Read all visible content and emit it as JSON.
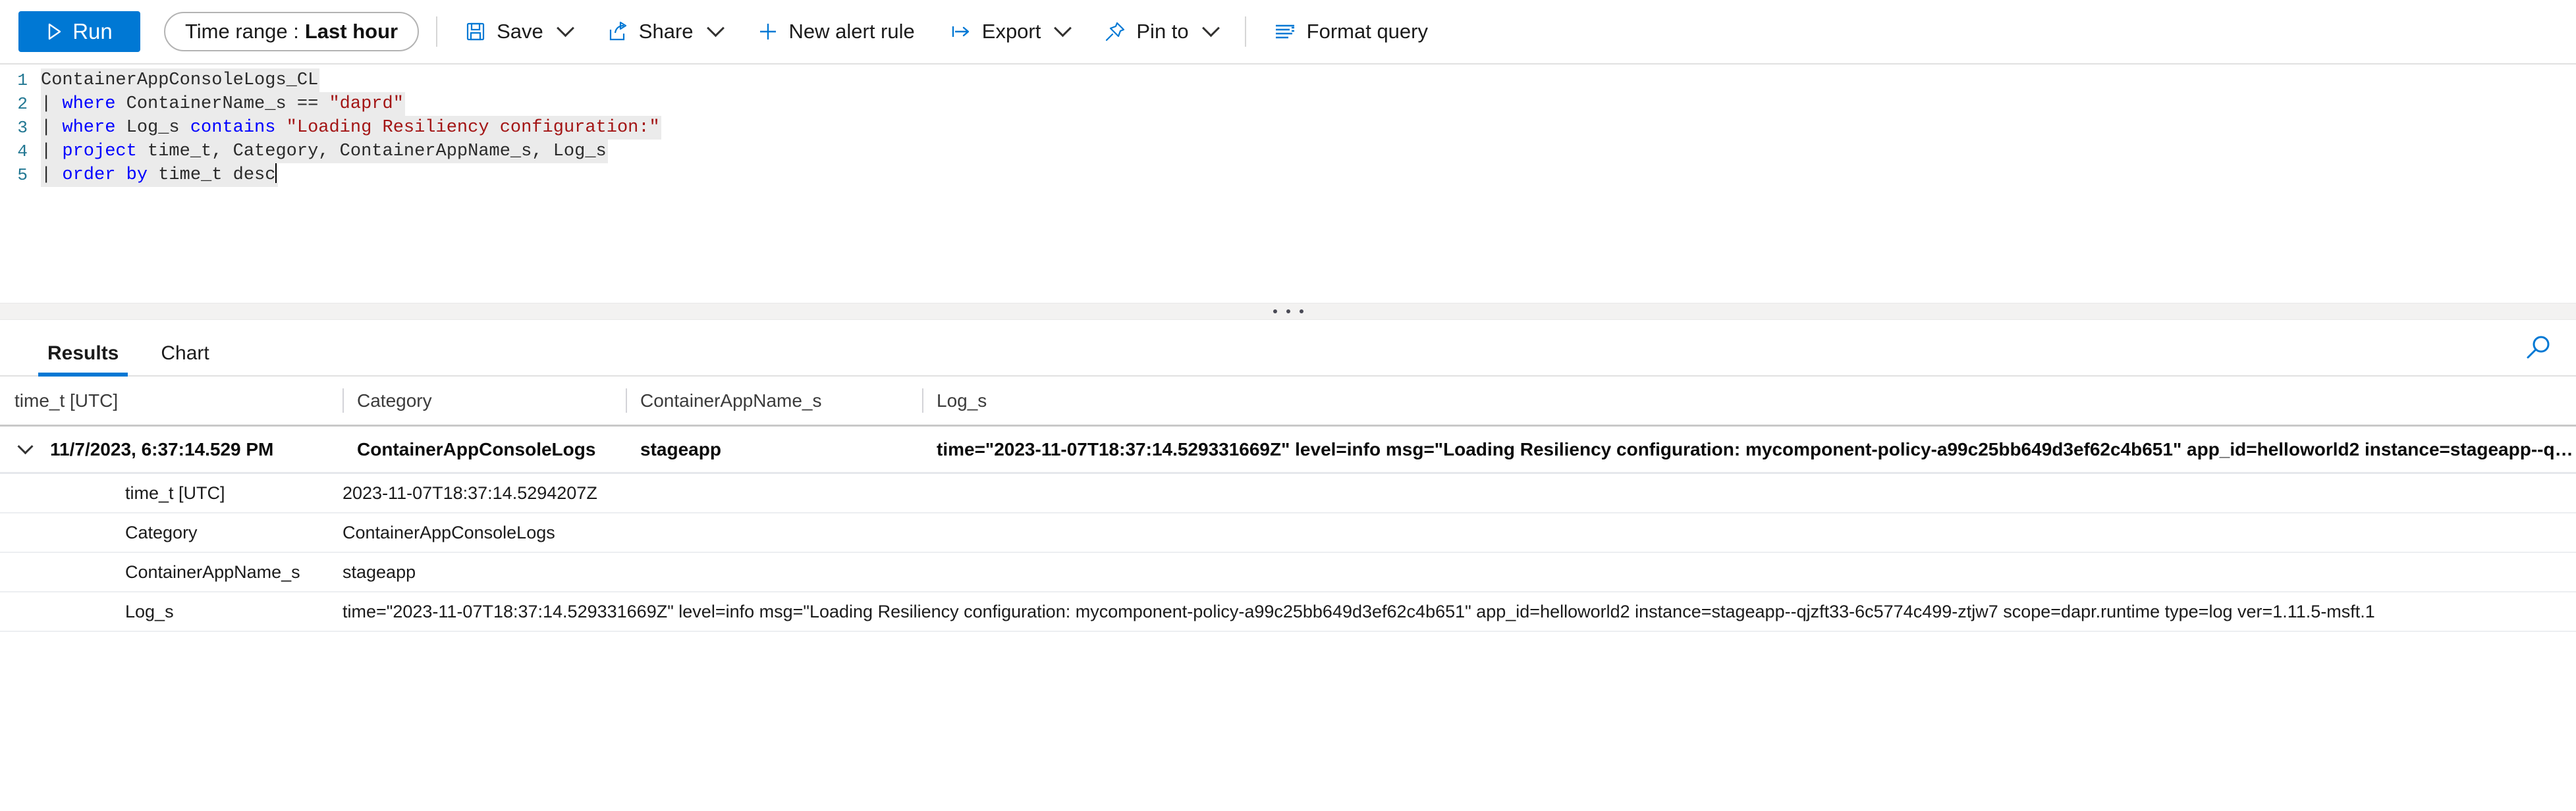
{
  "toolbar": {
    "run_label": "Run",
    "time_range_label": "Time range :",
    "time_range_value": "Last hour",
    "save_label": "Save",
    "share_label": "Share",
    "new_alert_rule_label": "New alert rule",
    "export_label": "Export",
    "pin_to_label": "Pin to",
    "format_query_label": "Format query",
    "accent_color": "#0078d4"
  },
  "editor": {
    "lines": [
      {
        "number": "1",
        "text": "ContainerAppConsoleLogs_CL"
      },
      {
        "number": "2",
        "text": "| where ContainerName_s == \"daprd\""
      },
      {
        "number": "3",
        "text": "| where Log_s contains \"Loading Resiliency configuration:\""
      },
      {
        "number": "4",
        "text": "| project time_t, Category, ContainerAppName_s, Log_s"
      },
      {
        "number": "5",
        "text": "| order by time_t desc"
      }
    ],
    "keyword_color": "#0000ff",
    "string_color": "#a31515",
    "line_number_color": "#237893"
  },
  "tabs": {
    "items": [
      {
        "label": "Results",
        "active": true
      },
      {
        "label": "Chart",
        "active": false
      }
    ],
    "search_icon": "search-icon"
  },
  "results": {
    "columns": [
      "time_t [UTC]",
      "Category",
      "ContainerAppName_s",
      "Log_s"
    ],
    "rows": [
      {
        "time_t": "11/7/2023, 6:37:14.529 PM",
        "category": "ContainerAppConsoleLogs",
        "container_app_name": "stageapp",
        "log_prefix": "time=\"2023-11-07T18:37:14.529331669Z\" level=info msg=",
        "log_highlight": "\"Loading Resiliency configuration: mycomponent-policy-a99c25bb649d3ef62c4b651\"",
        "log_suffix": " app_id=helloworld2 instance=stageapp--qj…",
        "highlight_color": "#fc2020",
        "expanded": true,
        "details": [
          {
            "key": "time_t [UTC]",
            "value": "2023-11-07T18:37:14.5294207Z"
          },
          {
            "key": "Category",
            "value": "ContainerAppConsoleLogs"
          },
          {
            "key": "ContainerAppName_s",
            "value": "stageapp"
          },
          {
            "key": "Log_s",
            "value": "time=\"2023-11-07T18:37:14.529331669Z\" level=info msg=\"Loading Resiliency configuration: mycomponent-policy-a99c25bb649d3ef62c4b651\" app_id=helloworld2 instance=stageapp--qjzft33-6c5774c499-ztjw7 scope=dapr.runtime type=log ver=1.11.5-msft.1"
          }
        ]
      }
    ]
  }
}
